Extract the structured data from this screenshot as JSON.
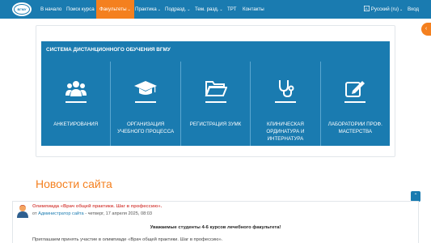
{
  "navbar": {
    "logo_text": "ВГМУ",
    "items": [
      {
        "label": "В начало"
      },
      {
        "label": "Поиск курса"
      },
      {
        "label": "Факультеты",
        "caret": "⌄"
      },
      {
        "label": "Практика",
        "caret": "⌄"
      },
      {
        "label": "Подразд.",
        "caret": "⌄"
      },
      {
        "label": "Тем. разд.",
        "caret": "⌄"
      },
      {
        "label": "ТРТ"
      },
      {
        "label": "Контакты"
      }
    ],
    "language": "Русский (ru)",
    "language_caret": "⌄",
    "login": "Вход",
    "active_color": "#f4801f",
    "bar_color": "#1a7bb0"
  },
  "panel": {
    "title": "СИСТЕМА ДИСТАНЦИОННОГО ОБУЧЕНИЯ ВГМУ",
    "tiles": [
      {
        "label": "АНКЕТИРОВАНИЯ",
        "icon": "users-icon"
      },
      {
        "label": "ОРГАНИЗАЦИЯ УЧЕБНОГО ПРОЦЕССА",
        "icon": "graduation-cap-icon"
      },
      {
        "label": "РЕГИСТРАЦИЯ ЗУМК",
        "icon": "folder-open-icon"
      },
      {
        "label": "КЛИНИЧЕСКАЯ ОРДИНАТУРА И ИНТЕРНАТУРА",
        "icon": "stethoscope-icon"
      },
      {
        "label": "ЛАБОРАТОРИИ ПРОФ. МАСТЕРСТВА",
        "icon": "edit-icon"
      }
    ]
  },
  "news": {
    "section_title": "Новости сайта",
    "post": {
      "title": "Олимпиада «Врач общей практики. Шаг в профессию».",
      "meta_prefix": "от ",
      "author": "Администратор сайта",
      "date": " - четверг, 17 апреля 2025, 08:03",
      "bold_line": "Уважаемые студенты 4-6 курсов лечебного факультета!",
      "text": "Приглашаем принять участие в олимпиаде «Врач общей практики. Шаг в профессию»."
    }
  }
}
